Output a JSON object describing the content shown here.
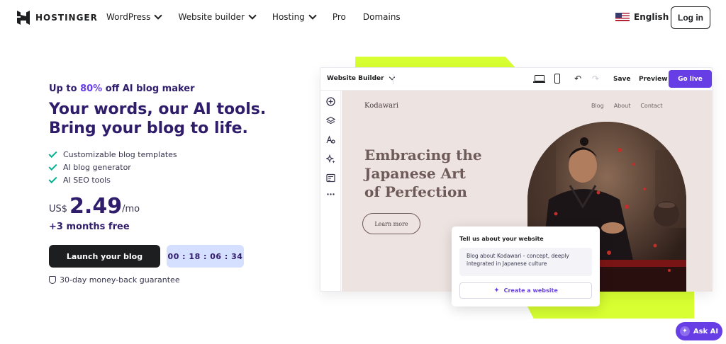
{
  "nav": {
    "brand": "HOSTINGER",
    "items": [
      {
        "label": "WordPress",
        "has_dropdown": true
      },
      {
        "label": "Website builder",
        "has_dropdown": true
      },
      {
        "label": "Hosting",
        "has_dropdown": true
      },
      {
        "label": "Pro",
        "has_dropdown": false
      },
      {
        "label": "Domains",
        "has_dropdown": false
      }
    ],
    "language": "English",
    "login": "Log in"
  },
  "hero": {
    "promo_prefix": "Up to ",
    "promo_highlight": "80%",
    "promo_suffix": " off AI blog maker",
    "headline_line1": "Your words, our AI tools.",
    "headline_line2": "Bring your blog to life.",
    "features": [
      "Customizable blog templates",
      "AI blog generator",
      "AI SEO tools"
    ],
    "price_currency": "US$",
    "price_amount": "2.49",
    "price_period": "/mo",
    "bonus": "+3 months free",
    "cta": "Launch your blog",
    "timer": "00 : 18 : 06 : 34",
    "guarantee": "30-day money-back guarantee"
  },
  "builder": {
    "title": "Website Builder",
    "save": "Save",
    "preview": "Preview",
    "go_live": "Go live",
    "site": {
      "logo": "Kodawari",
      "nav": [
        "Blog",
        "About",
        "Contact"
      ],
      "headline_line1": "Embracing the",
      "headline_line2": "Japanese Art",
      "headline_line3": "of Perfection",
      "learn_more": "Learn more"
    }
  },
  "popup": {
    "title": "Tell us about your website",
    "textarea": "Blog about Kodawari - concept, deeply integrated in Japanese culture",
    "button": "Create a website"
  },
  "ask_ai": "Ask AI",
  "colors": {
    "primary": "#673de6",
    "dark": "#1d1e20",
    "heading": "#2f1c6a",
    "lime": "#d7ff31",
    "timer_bg": "#d5dfff",
    "check": "#00b090"
  }
}
